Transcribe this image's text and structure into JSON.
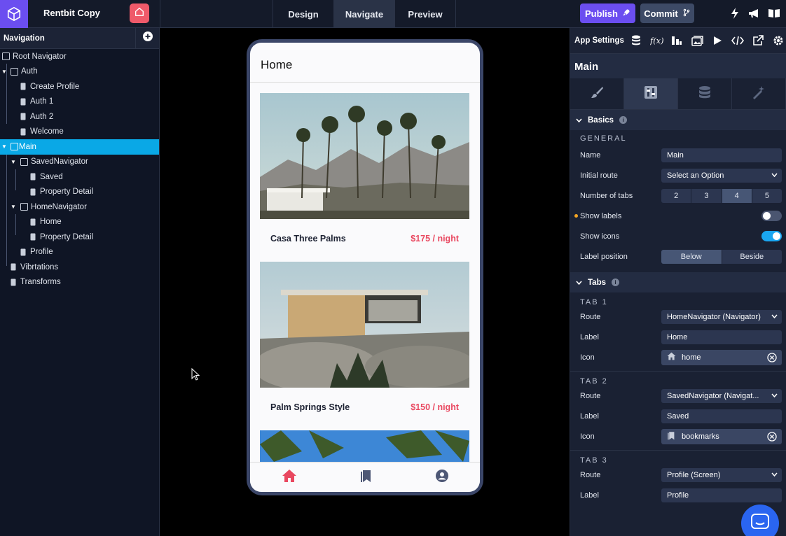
{
  "app": {
    "name": "Rentbit Copy"
  },
  "modes": [
    {
      "label": "Design",
      "active": false
    },
    {
      "label": "Navigate",
      "active": true
    },
    {
      "label": "Preview",
      "active": false
    }
  ],
  "actions": {
    "publish": "Publish",
    "commit": "Commit"
  },
  "navigation": {
    "title": "Navigation",
    "nodes": [
      {
        "label": "Root Navigator",
        "type": "navigator"
      },
      {
        "label": "Auth",
        "type": "navigator"
      },
      {
        "label": "Create Profile",
        "type": "screen"
      },
      {
        "label": "Auth 1",
        "type": "screen"
      },
      {
        "label": "Auth 2",
        "type": "screen"
      },
      {
        "label": "Welcome",
        "type": "screen"
      },
      {
        "label": "Main",
        "type": "navigator",
        "selected": true
      },
      {
        "label": "SavedNavigator",
        "type": "navigator"
      },
      {
        "label": "Saved",
        "type": "screen"
      },
      {
        "label": "Property Detail",
        "type": "screen"
      },
      {
        "label": "HomeNavigator",
        "type": "navigator"
      },
      {
        "label": "Home",
        "type": "screen"
      },
      {
        "label": "Property Detail",
        "type": "screen"
      },
      {
        "label": "Profile",
        "type": "screen"
      },
      {
        "label": "Vibrtations",
        "type": "screen"
      },
      {
        "label": "Transforms",
        "type": "screen"
      }
    ]
  },
  "preview": {
    "title": "Home",
    "listings": [
      {
        "name": "Casa Three Palms",
        "price": "$175 / night"
      },
      {
        "name": "Palm Springs Style",
        "price": "$150 / night"
      }
    ],
    "tabbar_icons": [
      "home-icon",
      "bookmarks-icon",
      "profile-icon"
    ],
    "accent": "#e94860"
  },
  "settings": {
    "app_settings_label": "App Settings",
    "screen_name": "Main",
    "basics": {
      "title": "Basics",
      "group": "GENERAL",
      "name_label": "Name",
      "name_value": "Main",
      "initial_route_label": "Initial route",
      "initial_route_value": "Select an Option",
      "num_tabs_label": "Number of tabs",
      "num_tabs_options": [
        "2",
        "3",
        "4",
        "5"
      ],
      "num_tabs_selected": "4",
      "show_labels_label": "Show labels",
      "show_labels": false,
      "show_icons_label": "Show icons",
      "show_icons": true,
      "label_position_label": "Label position",
      "label_position_options": [
        "Below",
        "Beside"
      ],
      "label_position_selected": "Below"
    },
    "tabs_section": {
      "title": "Tabs",
      "route_label": "Route",
      "label_label": "Label",
      "icon_label": "Icon",
      "items": [
        {
          "title": "TAB 1",
          "route": "HomeNavigator (Navigator)",
          "label": "Home",
          "icon": "home"
        },
        {
          "title": "TAB 2",
          "route": "SavedNavigator (Navigat...",
          "label": "Saved",
          "icon": "bookmarks"
        },
        {
          "title": "TAB 3",
          "route": "Profile (Screen)",
          "label": "Profile",
          "icon": ""
        }
      ]
    }
  }
}
